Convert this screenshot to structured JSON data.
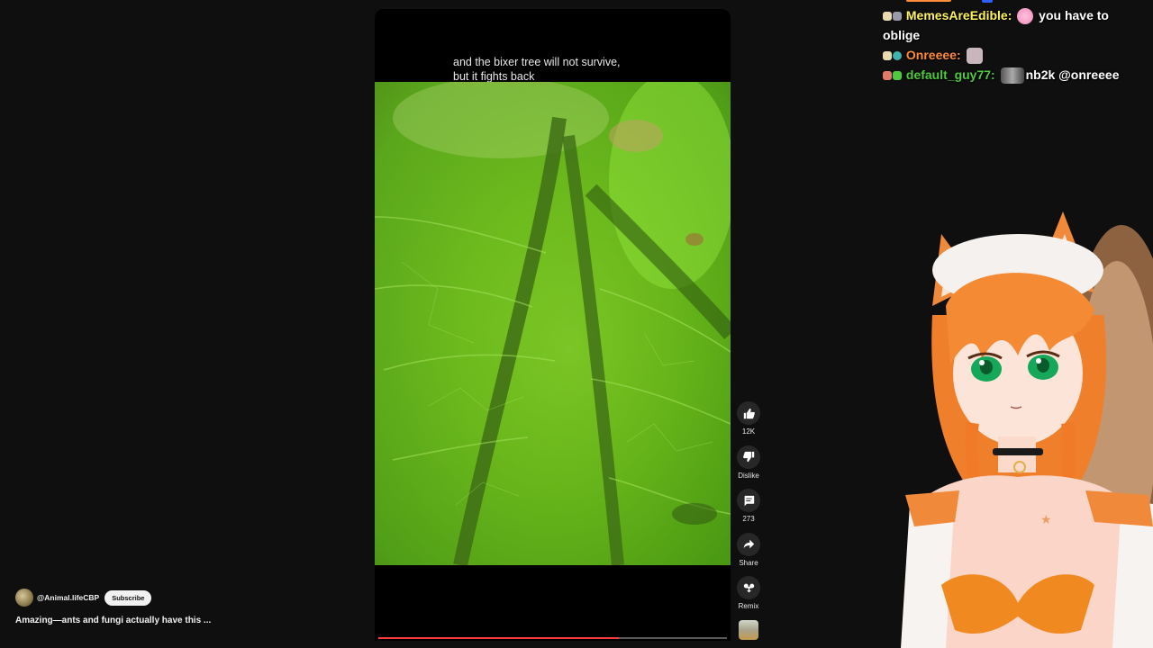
{
  "video": {
    "caption_line1": "and the bixer tree will not survive,",
    "caption_line2": "but it fights back",
    "progress_fraction": 0.69
  },
  "actions": [
    {
      "icon": "thumbs-up-icon",
      "label": "12K"
    },
    {
      "icon": "thumbs-down-icon",
      "label": "Dislike"
    },
    {
      "icon": "comment-icon",
      "label": "273"
    },
    {
      "icon": "share-icon",
      "label": "Share"
    },
    {
      "icon": "remix-icon",
      "label": "Remix"
    }
  ],
  "channel": {
    "name": "@Animal.lifeCBP",
    "subscribe_label": "Subscribe"
  },
  "title": "Amazing—ants and fungi actually have this ...",
  "chat": [
    {
      "user": "MemesAreEdible",
      "user_color": "#fff35a",
      "message": "you have to oblige"
    },
    {
      "user": "Onreeee",
      "user_color": "#ff8c3a",
      "message": ""
    },
    {
      "user": "default_guy77",
      "user_color": "#4ecb3c",
      "message": "nb2k @onreeee"
    }
  ]
}
